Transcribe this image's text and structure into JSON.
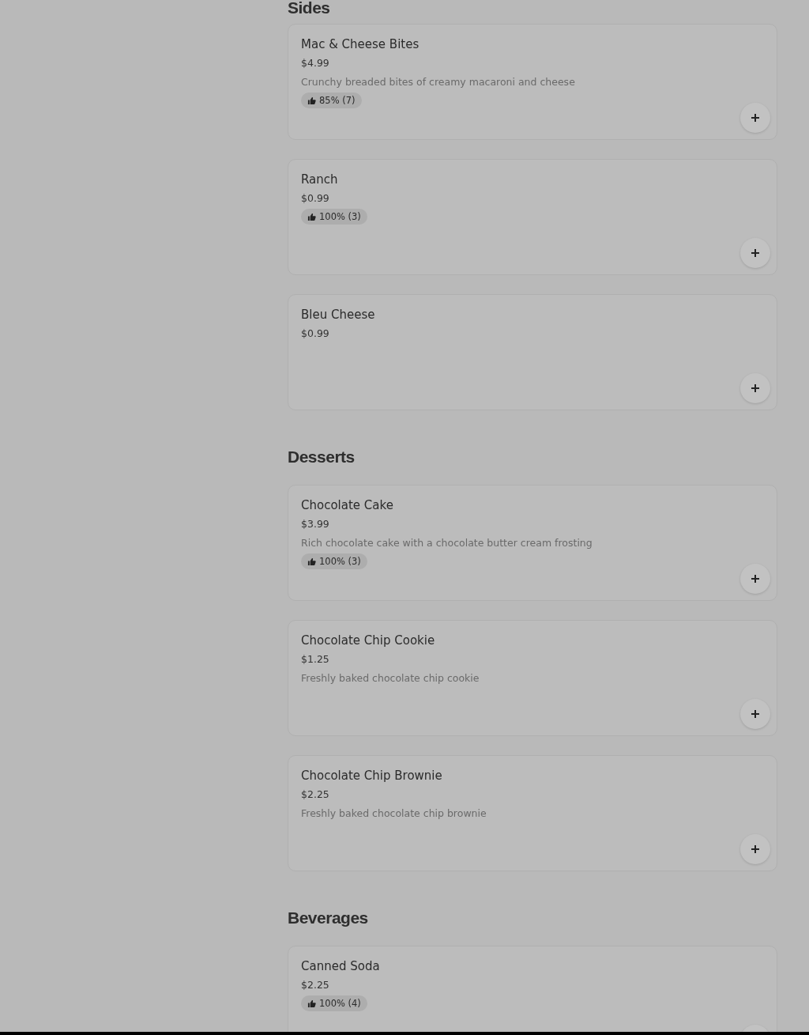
{
  "sections": [
    {
      "heading": "Sides",
      "items": [
        {
          "name": "Mac & Cheese Bites",
          "price": "$4.99",
          "description": "Crunchy breaded bites of creamy macaroni and cheese",
          "rating": "85% (7)"
        },
        {
          "name": "Ranch",
          "price": "$0.99",
          "rating": "100% (3)"
        },
        {
          "name": "Bleu Cheese",
          "price": "$0.99"
        }
      ]
    },
    {
      "heading": "Desserts",
      "items": [
        {
          "name": "Chocolate Cake",
          "price": "$3.99",
          "description": "Rich chocolate cake with a chocolate butter cream frosting",
          "rating": "100% (3)"
        },
        {
          "name": "Chocolate Chip Cookie",
          "price": "$1.25",
          "description": "Freshly baked chocolate chip cookie"
        },
        {
          "name": "Chocolate Chip Brownie",
          "price": "$2.25",
          "description": "Freshly baked chocolate chip brownie"
        }
      ]
    },
    {
      "heading": "Beverages",
      "items": [
        {
          "name": "Canned Soda",
          "price": "$2.25",
          "rating": "100% (4)"
        }
      ]
    }
  ]
}
